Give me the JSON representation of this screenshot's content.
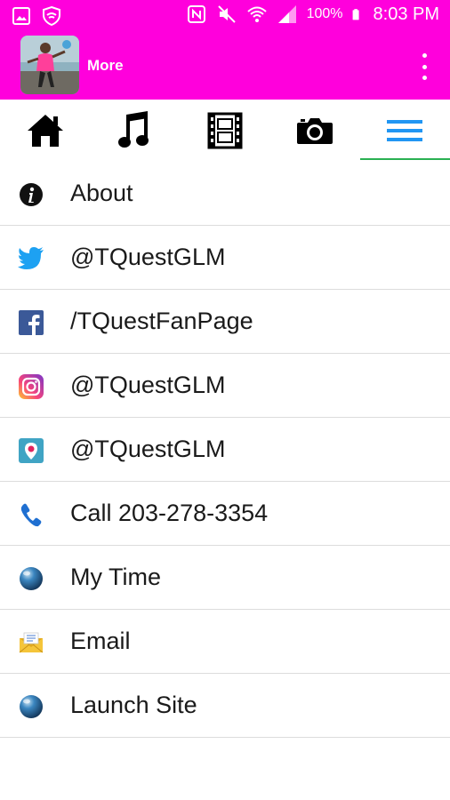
{
  "status_bar": {
    "battery": "100%",
    "time": "8:03 PM"
  },
  "app_bar": {
    "title": "More"
  },
  "tabs": [
    {
      "name": "home-tab",
      "icon": "home-icon"
    },
    {
      "name": "music-tab",
      "icon": "music-note-icon"
    },
    {
      "name": "video-tab",
      "icon": "film-icon"
    },
    {
      "name": "photo-tab",
      "icon": "camera-icon"
    },
    {
      "name": "more-tab",
      "icon": "menu-icon",
      "active": true
    }
  ],
  "menu_items": [
    {
      "label": "About",
      "icon": "info-icon"
    },
    {
      "label": "@TQuestGLM",
      "icon": "twitter-icon"
    },
    {
      "label": "/TQuestFanPage",
      "icon": "facebook-icon"
    },
    {
      "label": "@TQuestGLM",
      "icon": "instagram-icon"
    },
    {
      "label": "@TQuestGLM",
      "icon": "periscope-icon"
    },
    {
      "label": "Call 203-278-3354",
      "icon": "phone-icon"
    },
    {
      "label": "My Time",
      "icon": "globe-icon"
    },
    {
      "label": "Email",
      "icon": "envelope-icon"
    },
    {
      "label": "Launch Site",
      "icon": "globe-icon"
    }
  ],
  "colors": {
    "header": "#ff00dc",
    "tab_indicator": "#2ab052",
    "accent_blue": "#2196f3"
  }
}
